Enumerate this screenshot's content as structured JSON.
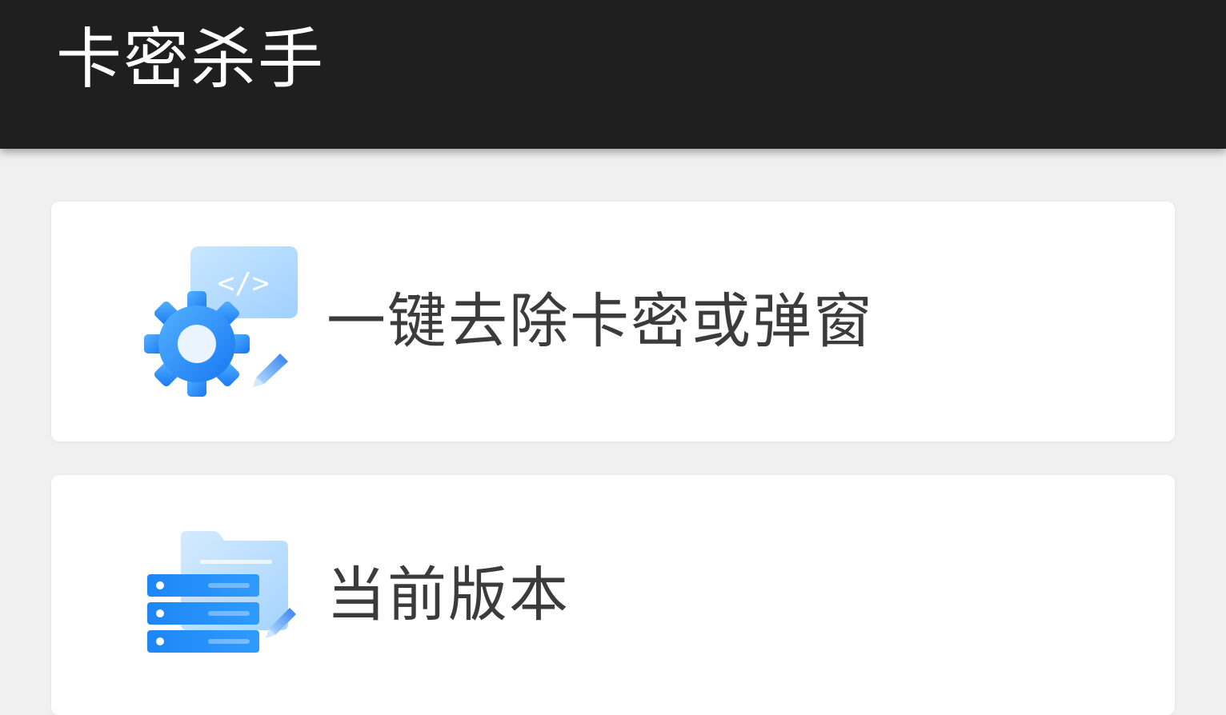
{
  "app_bar": {
    "title": "卡密杀手"
  },
  "cards": [
    {
      "label": "一键去除卡密或弹窗",
      "icon": "gear-code-icon"
    },
    {
      "label": "当前版本",
      "icon": "server-folder-icon"
    }
  ],
  "colors": {
    "app_bar": "#1f1f1f",
    "background": "#f0f0f0",
    "card": "#ffffff",
    "icon_accent": "#2f8cff",
    "label_text": "#3b3b3b"
  }
}
